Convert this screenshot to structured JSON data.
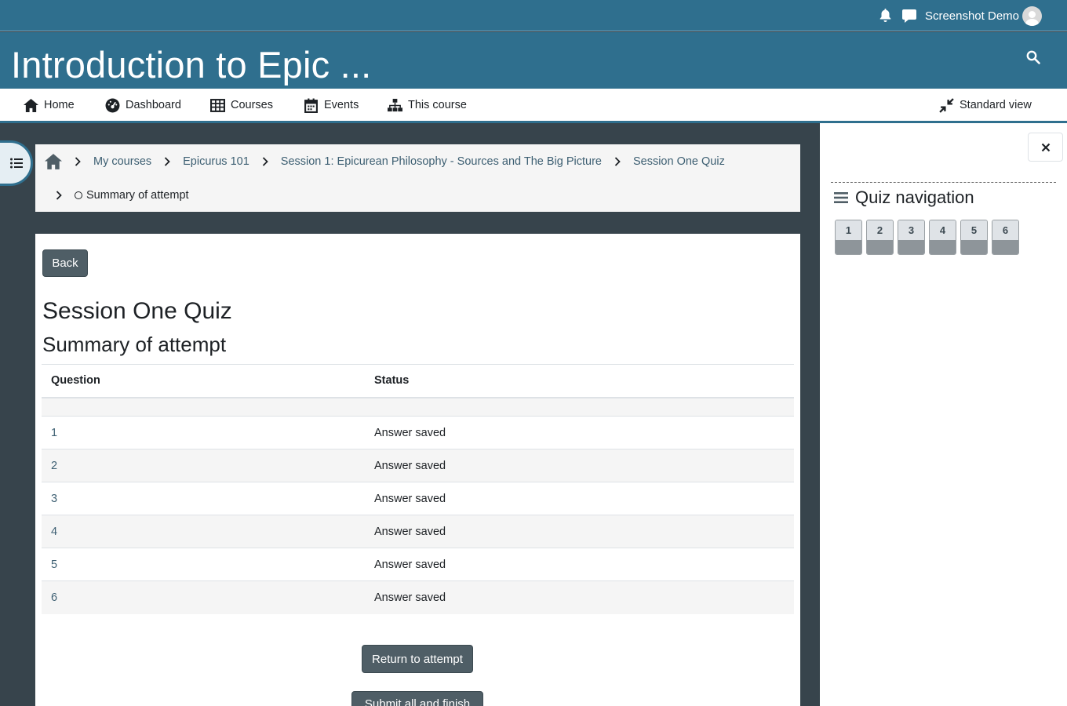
{
  "topbar": {
    "user_name": "Screenshot Demo",
    "icons": [
      "bell-icon",
      "chat-icon",
      "user-avatar"
    ]
  },
  "header": {
    "course_title": "Introduction to Epic ..."
  },
  "nav": {
    "home": "Home",
    "dashboard": "Dashboard",
    "courses": "Courses",
    "events": "Events",
    "this_course": "This course",
    "standard_view": "Standard view"
  },
  "breadcrumb": {
    "items": [
      "My courses",
      "Epicurus 101",
      "Session 1: Epicurean Philosophy - Sources and The Big Picture",
      "Session One Quiz"
    ],
    "current": "Summary of attempt"
  },
  "main": {
    "back_label": "Back",
    "title": "Session One Quiz",
    "subtitle": "Summary of attempt",
    "table": {
      "headers": [
        "Question",
        "Status"
      ],
      "rows": [
        {
          "question": "1",
          "status": "Answer saved"
        },
        {
          "question": "2",
          "status": "Answer saved"
        },
        {
          "question": "3",
          "status": "Answer saved"
        },
        {
          "question": "4",
          "status": "Answer saved"
        },
        {
          "question": "5",
          "status": "Answer saved"
        },
        {
          "question": "6",
          "status": "Answer saved"
        }
      ]
    },
    "return_label": "Return to attempt",
    "submit_label": "Submit all and finish"
  },
  "drawer": {
    "title": "Quiz navigation",
    "questions": [
      "1",
      "2",
      "3",
      "4",
      "5",
      "6"
    ]
  },
  "colors": {
    "brand": "#2f6f8e",
    "page_bg": "#37444c",
    "button": "#4f5e66",
    "link": "#3d5f72"
  }
}
